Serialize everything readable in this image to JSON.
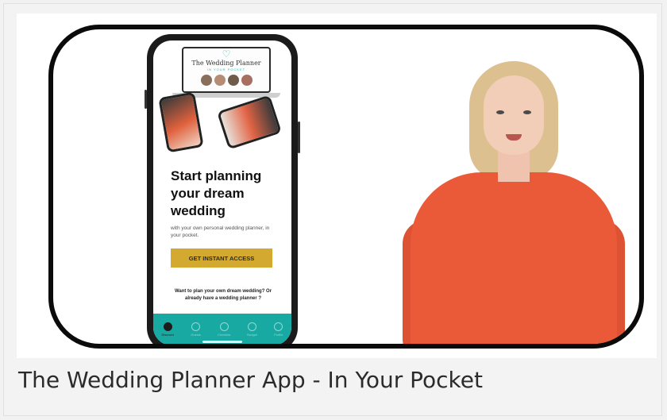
{
  "video": {
    "phone_screen": {
      "banner_title": "The Wedding Planner",
      "banner_subtitle": "IN YOUR POCKET",
      "headline": "Start planning your dream wedding",
      "subline": "with your own personal wedding planner, in your pocket.",
      "cta_label": "GET INSTANT ACCESS",
      "question": "Want to plan your own dream wedding? Or already have a wedding planner ?",
      "nav_items": [
        {
          "label": "Discover",
          "icon": "compass-icon",
          "active": true
        },
        {
          "label": "Guests",
          "icon": "guests-icon",
          "active": false
        },
        {
          "label": "Checklist",
          "icon": "checklist-icon",
          "active": false
        },
        {
          "label": "Budget",
          "icon": "budget-icon",
          "active": false
        },
        {
          "label": "Profile",
          "icon": "profile-icon",
          "active": false
        }
      ]
    }
  },
  "caption": "The Wedding Planner App - In Your Pocket",
  "colors": {
    "accent_teal": "#18a9a2",
    "cta_gold": "#d4a92f",
    "presenter_top": "#ea5a38"
  }
}
